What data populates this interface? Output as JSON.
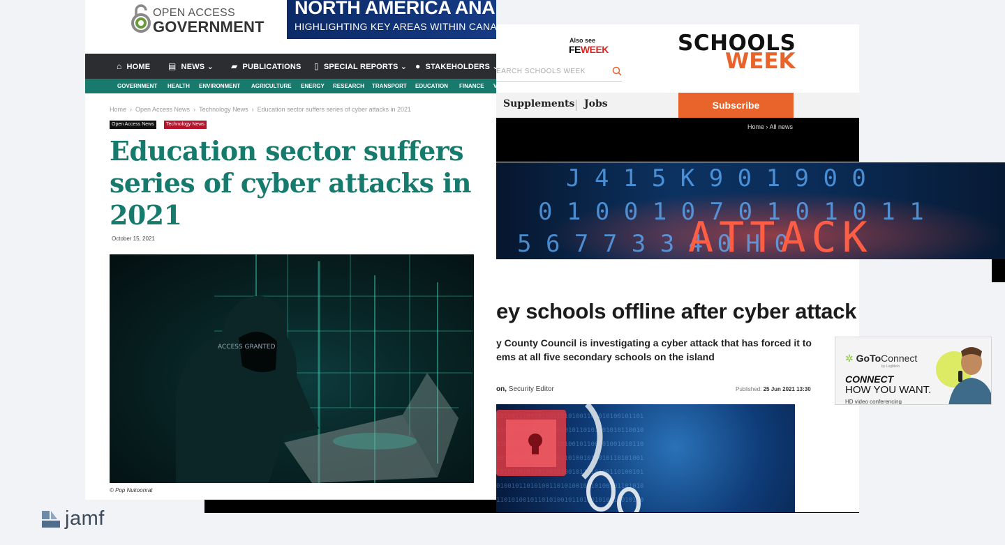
{
  "oag": {
    "logo_line1": "OPEN ACCESS",
    "logo_line2": "GOVERNMENT",
    "banner_title": "NORTH AMERICA ANA",
    "banner_subtitle": "HIGHLIGHTING KEY AREAS WITHIN CANADA A",
    "nav": [
      {
        "label": "HOME",
        "icon": "home-icon",
        "glyph": "⌂"
      },
      {
        "label": "NEWS",
        "icon": "newspaper-icon",
        "glyph": "▤",
        "dropdown": true
      },
      {
        "label": "PUBLICATIONS",
        "icon": "book-icon",
        "glyph": "▰"
      },
      {
        "label": "SPECIAL REPORTS",
        "icon": "document-icon",
        "glyph": "▯",
        "dropdown": true
      },
      {
        "label": "STAKEHOLDERS",
        "icon": "user-icon",
        "glyph": "●",
        "dropdown": true
      }
    ],
    "subnav": [
      "GOVERNMENT",
      "HEALTH",
      "ENVIRONMENT",
      "AGRICULTURE",
      "ENERGY",
      "RESEARCH",
      "TRANSPORT",
      "EDUCATION",
      "FINANCE",
      "V"
    ],
    "breadcrumb": [
      "Home",
      "Open Access News",
      "Technology News",
      "Education sector suffers series of cyber attacks in 2021"
    ],
    "tags": [
      "Open Access News",
      "Technology News"
    ],
    "title": "Education sector suffers series of cyber attacks in 2021",
    "date": "October 15, 2021",
    "image_credit": "© Pop Nukoonrat",
    "image_overlay_text": "ACCESS GRANTED"
  },
  "sw": {
    "also_see": "Also see",
    "feweek_fe": "FE",
    "feweek_week": "WEEK",
    "search_placeholder": "EARCH SCHOOLS WEEK",
    "logo_line1": "SCHOOLS",
    "logo_line2": "WEEK",
    "nav": [
      "Supplements",
      "Jobs"
    ],
    "subscribe": "Subscribe",
    "breadcrumb": "Home › All news",
    "attack_word": "ATTACK",
    "binary_rows": [
      "J 4 1 5 K 9 0 1 9 0 0",
      "0 1 0 0 1 0 7 0 1 0 1 0 1 1",
      "5 6 7 7 3 3 4 0 H 0"
    ],
    "headline": "ey schools offline after cyber attack",
    "standfirst": "y County Council is investigating a cyber attack that has forced it to ems at all five secondary schools on the island",
    "standfirst_line1": "y County Council is investigating a cyber attack that has forced it to",
    "standfirst_line2": "ems at all five secondary schools on the island",
    "byline_name": "on,",
    "byline_role": "Security Editor",
    "published_label": "Published:",
    "published_date": "25 Jun 2021 13:30"
  },
  "ad": {
    "brand_goto": "GoTo",
    "brand_connect": "Connect",
    "by": "by LogMeIn",
    "line1": "CONNECT",
    "line2": "HOW YOU WANT.",
    "line3": "HD video conferencing"
  },
  "footer": {
    "brand": "jamf"
  },
  "colors": {
    "oag_green": "#167b6c",
    "oag_tag_red": "#b3152c",
    "sw_orange": "#e9642a",
    "fe_red": "#e0231f",
    "na_blue": "#0b2a66"
  }
}
